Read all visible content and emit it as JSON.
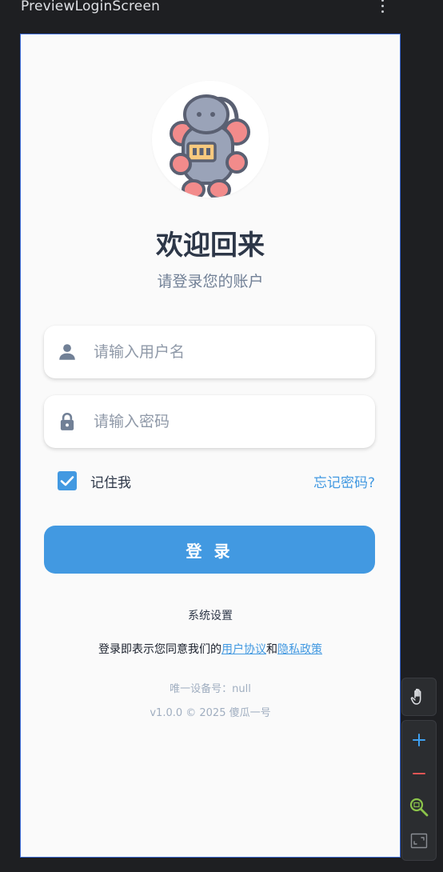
{
  "ide": {
    "preview_title": "PreviewLoginScreen"
  },
  "login": {
    "title": "欢迎回来",
    "subtitle": "请登录您的账户",
    "username_placeholder": "请输入用户名",
    "password_placeholder": "请输入密码",
    "remember_label": "记住我",
    "remember_checked": true,
    "forgot_label": "忘记密码?",
    "login_button": "登 录",
    "settings_label": "系统设置",
    "agreement": {
      "prefix": "登录即表示您同意我们的",
      "terms": "用户协议",
      "joiner": "和",
      "privacy": "隐私政策"
    },
    "device_id": "唯一设备号：null",
    "version": "v1.0.0 © 2025 傻瓜一号"
  },
  "icons": {
    "avatar": "robot-icon",
    "username": "person-icon",
    "password": "lock-icon",
    "remember": "checkmark-icon",
    "pan_tool": "hand-icon",
    "zoom_in": "plus-icon",
    "zoom_out": "minus-icon",
    "zoom_reset": "magnifier-icon",
    "fit_screen": "fit-screen-icon"
  },
  "colors": {
    "primary": "#4299e1",
    "title_text": "#2d3748",
    "subtitle_text": "#718096",
    "muted_text": "#a0aec0",
    "screen_background": "#fafafa",
    "ide_background": "#1e1f22"
  }
}
